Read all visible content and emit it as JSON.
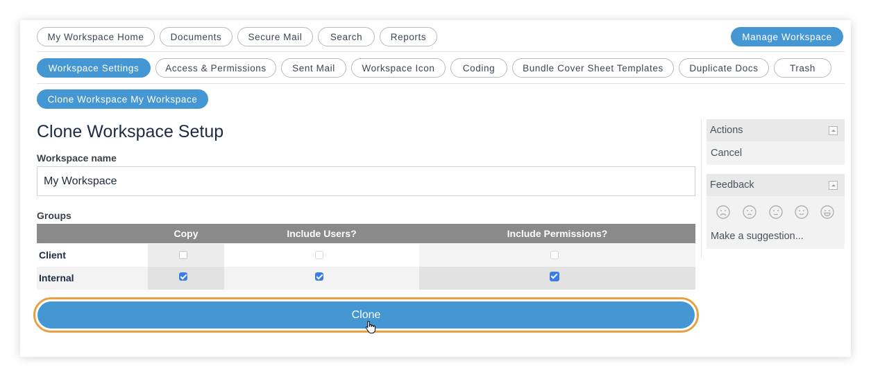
{
  "nav_primary": [
    {
      "label": "My Workspace Home"
    },
    {
      "label": "Documents"
    },
    {
      "label": "Secure Mail"
    },
    {
      "label": "Search"
    },
    {
      "label": "Reports"
    }
  ],
  "manage_workspace": "Manage Workspace",
  "nav_secondary": [
    {
      "label": "Workspace Settings",
      "active": true
    },
    {
      "label": "Access & Permissions"
    },
    {
      "label": "Sent Mail"
    },
    {
      "label": "Workspace Icon"
    },
    {
      "label": "Coding"
    },
    {
      "label": "Bundle Cover Sheet Templates"
    },
    {
      "label": "Duplicate Docs"
    },
    {
      "label": "Trash"
    }
  ],
  "breadcrumb_pill": "Clone Workspace My Workspace",
  "page_title": "Clone Workspace Setup",
  "workspace_name": {
    "label": "Workspace name",
    "value": "My Workspace"
  },
  "groups": {
    "label": "Groups",
    "columns": [
      "",
      "Copy",
      "Include Users?",
      "Include Permissions?"
    ],
    "rows": [
      {
        "name": "Client",
        "copy": false,
        "include_users": false,
        "include_permissions": false
      },
      {
        "name": "Internal",
        "copy": true,
        "include_users": true,
        "include_permissions": true
      }
    ]
  },
  "clone_button": "Clone",
  "actions_panel": {
    "title": "Actions",
    "items": [
      "Cancel"
    ]
  },
  "feedback_panel": {
    "title": "Feedback",
    "faces": [
      "very-sad-face-icon",
      "sad-face-icon",
      "neutral-face-icon",
      "happy-face-icon",
      "very-happy-face-icon"
    ],
    "suggestion": "Make a suggestion..."
  },
  "colors": {
    "accent": "#4497d3",
    "focus_outline": "#e8a040",
    "checkbox_checked": "#3b7de6",
    "table_header": "#8a8a8a"
  }
}
